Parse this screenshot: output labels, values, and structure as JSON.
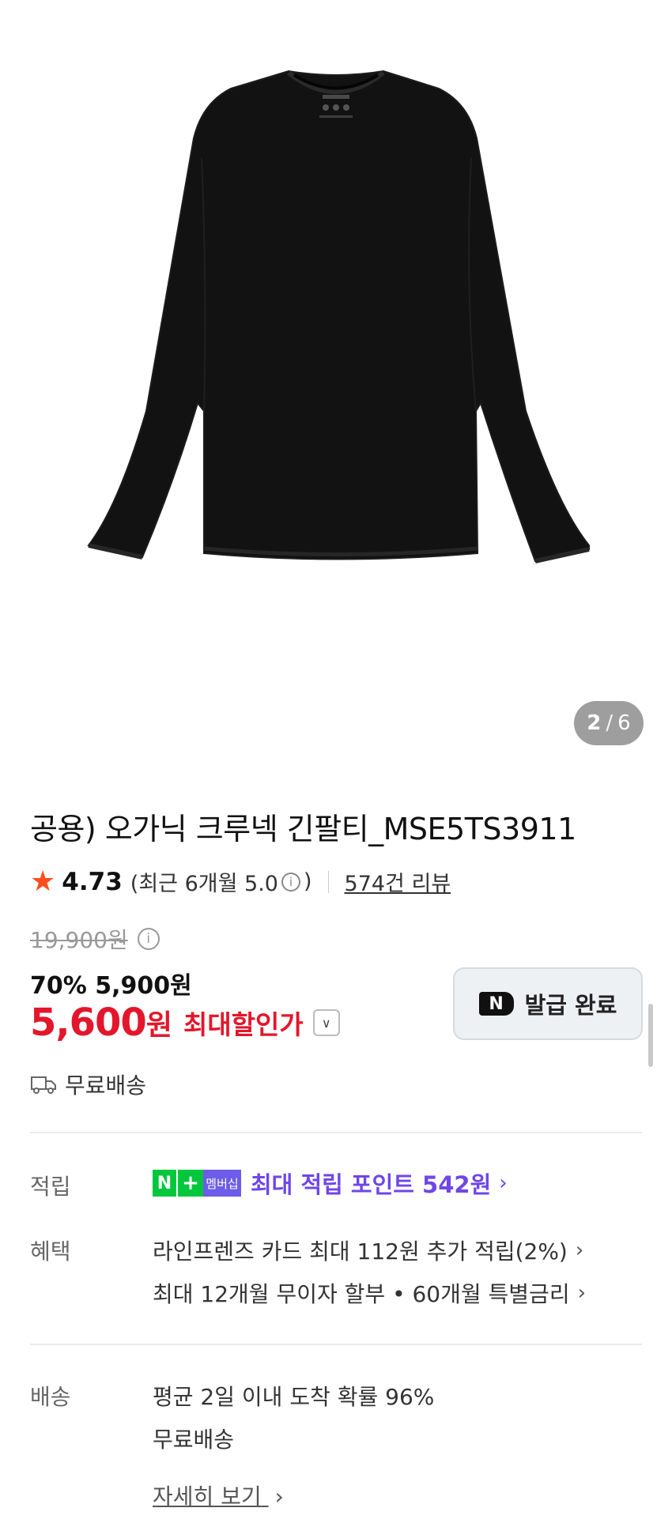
{
  "gallery": {
    "current": "2",
    "separator": "/",
    "total": "6",
    "image_subject": "black long-sleeve crew neck t-shirt",
    "garment_color": "#111111"
  },
  "product": {
    "title": "공용) 오가닉 크루넥 긴팔티_MSE5TS3911"
  },
  "rating": {
    "star": "★",
    "score": "4.73",
    "recent_prefix": "(최근 6개월 5.0",
    "info": "i",
    "recent_suffix": ")",
    "reviews": "574건 리뷰"
  },
  "price": {
    "original": "19,900원",
    "info": "i",
    "sale": "70% 5,900원",
    "best_amount": "5,600",
    "best_unit": "원",
    "best_label": "최대할인가",
    "dropdown": "∨"
  },
  "coupon": {
    "badge": "N",
    "label": "발급 완료"
  },
  "shipping_badge": {
    "label": "무료배송"
  },
  "points": {
    "label": "적립",
    "badge_n": "N",
    "badge_plus": "+",
    "badge_member": "멤버십",
    "text": "최대 적립 포인트 542원",
    "arrow": "›"
  },
  "benefits": {
    "label": "혜택",
    "items": [
      {
        "text": "라인프렌즈 카드 최대 112원 추가 적립(2%)",
        "arrow": "›"
      },
      {
        "text": "최대 12개월 무이자 할부 • 60개월 특별금리",
        "arrow": "›"
      }
    ]
  },
  "delivery": {
    "label": "배송",
    "line1": "평균 2일 이내 도착 확률 96%",
    "line2": "무료배송",
    "detail": "자세히 보기",
    "arrow": "›"
  },
  "colors": {
    "accent_red": "#e3162b",
    "star": "#ff4d1f",
    "naver_green": "#00c73c",
    "points_purple": "#6f46e8"
  }
}
